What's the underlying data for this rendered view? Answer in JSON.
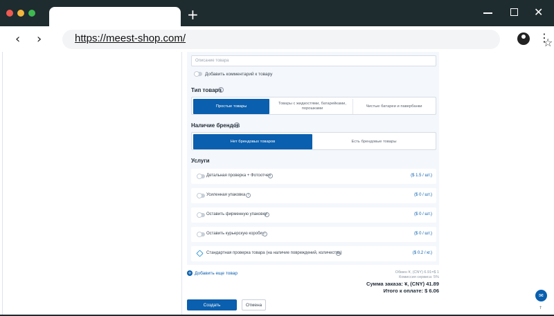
{
  "browser": {
    "url": "https://meest-shop.com/",
    "icons": {
      "new_tab": "plus-icon",
      "back": "arrow-left-icon",
      "forward": "arrow-right-icon",
      "bookmark": "star-icon",
      "profile": "account-icon",
      "menu": "kebab-menu-icon"
    }
  },
  "form": {
    "description_placeholder": "Описание товара",
    "add_comment_label": "Добавить комментарий к товару",
    "product_type": {
      "title": "Тип товара",
      "options": [
        "Простые товары",
        "Товары с жидкостями, батарейками, порошками",
        "Чистые батареи и павербанки"
      ],
      "selected": "Простые товары"
    },
    "brands": {
      "title": "Наличие брендов",
      "options": [
        "Нет брендовых товаров",
        "Есть брендовые товары"
      ],
      "selected": "Нет брендовых товаров"
    },
    "services": {
      "title": "Услуги",
      "items": [
        {
          "label": "Детальная проверка + Фотоотчет",
          "price": "($ 1.5 / шт.)"
        },
        {
          "label": "Усиленная упаковка",
          "price": "($ 0 / шт.)"
        },
        {
          "label": "Оставить фирменную упаковку",
          "price": "($ 0 / шт.)"
        },
        {
          "label": "Оставить курьерскую коробку",
          "price": "($ 0 / шт.)"
        },
        {
          "label": "Стандартная проверка товара (на наличие повреждений, количества)",
          "price": "($ 0.2 / кг.)"
        }
      ]
    },
    "add_more_label": "Добавить еще товар",
    "exchange_rate": "Обмен ¥, (CNY) 6.91=$ 1",
    "service_fee": "Комиссия сервиса: 5%",
    "order_sum": "Сумма заказа: ¥, (CNY) 41.89",
    "total_pay": "Итого к оплате: $ 6.06",
    "create_label": "Создать",
    "cancel_label": "Отмена"
  },
  "colors": {
    "accent": "#0a5fae",
    "chrome": "#1e2b2f",
    "panel": "#f4f7fb"
  }
}
